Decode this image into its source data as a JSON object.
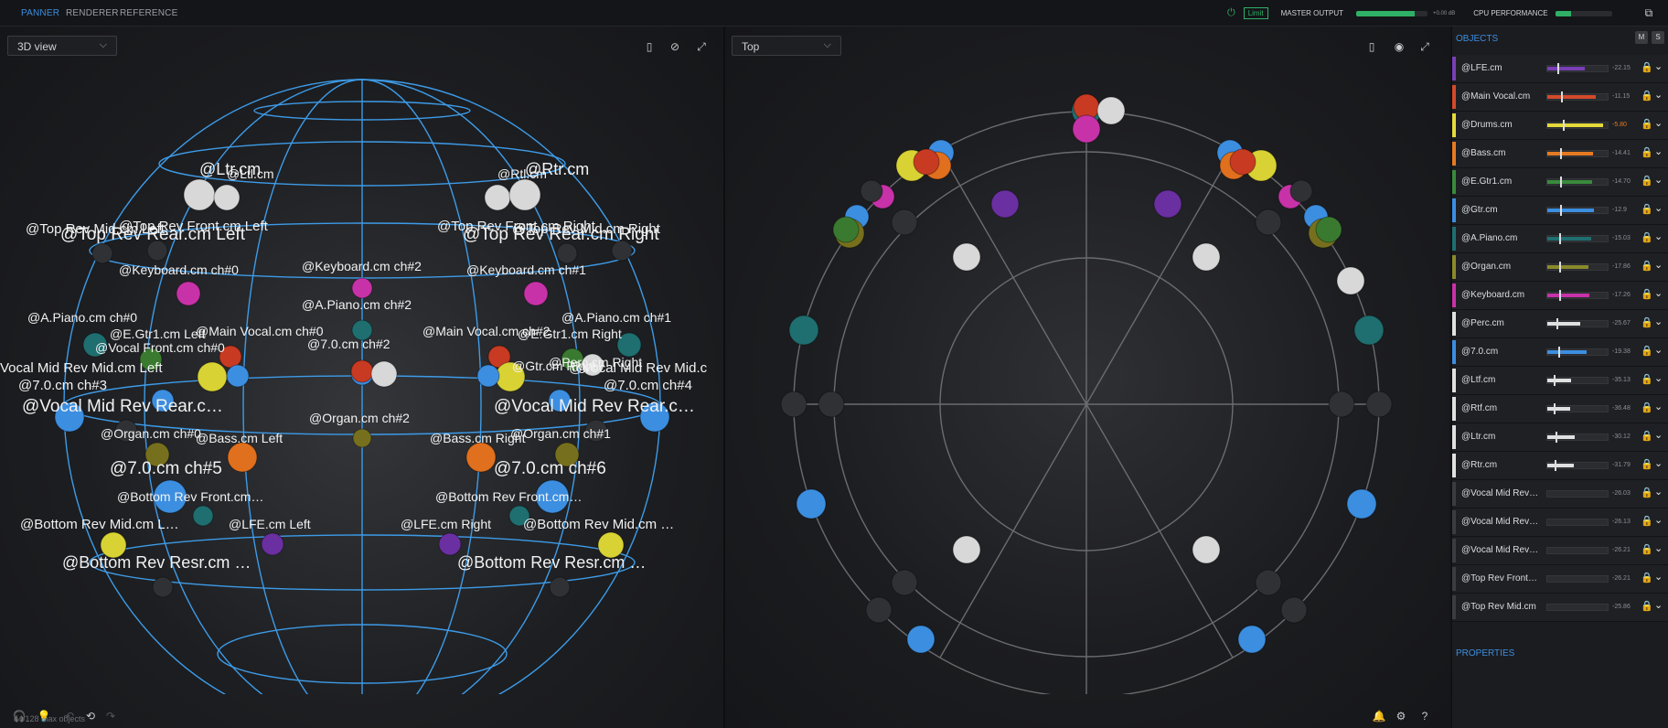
{
  "tabs": [
    "PANNER",
    "RENDERER",
    "REFERENCE"
  ],
  "topbar": {
    "limit_label": "Limit",
    "master_output_label": "MASTER OUTPUT",
    "master_output_db": "+0.00 dB",
    "master_output_level": 0.82,
    "cpu_label": "CPU PERFORMANCE",
    "cpu_level": 0.28,
    "accent_color": "#3c8ee0",
    "limit_color": "#2fb067"
  },
  "left_view": {
    "select_value": "3D view",
    "footer": "54/128 max objects",
    "labels": [
      "@Ltr.cm",
      "@Ltl.cm",
      "@Rtl.cm",
      "@Rtr.cm",
      "@Top Rev Mid.cm Left",
      "@Top Rev Front.cm Left",
      "@Top Rev Rear.cm Left",
      "@Top Rev Front.cm Right",
      "@Top Rev Mid.cm Right",
      "@Top Rev Rear.cm Right",
      "@Keyboard.cm ch#0",
      "@Keyboard.cm ch#2",
      "@Keyboard.cm ch#1",
      "@A.Piano.cm ch#2",
      "@A.Piano.cm ch#0",
      "@A.Piano.cm ch#1",
      "@E.Gtr1.cm Left",
      "@Main Vocal.cm ch#0",
      "@Main Vocal.cm ch#2",
      "@E.Gtr1.cm Right",
      "@Vocal Front.cm ch#0",
      "@7.0.cm ch#2",
      "@Perc.cm Right",
      "@Gtr.cm Right",
      "Vocal Mid Rev Mid.cm Left",
      "@Vocal Mid Rev Mid.c",
      "@7.0.cm ch#3",
      "@7.0.cm ch#4",
      "@Vocal Mid Rev Rear.c…",
      "@Vocal Mid Rev Rear.c…",
      "@Organ.cm ch#2",
      "@Organ.cm ch#0",
      "@Organ.cm ch#1",
      "@Bass.cm Left",
      "@Bass.cm Right",
      "@7.0.cm ch#5",
      "@7.0.cm ch#6",
      "@Bottom Rev Front.cm…",
      "@Bottom Rev Front.cm…",
      "@Bottom Rev Mid.cm L…",
      "@LFE.cm Left",
      "@LFE.cm Right",
      "@Bottom Rev Mid.cm …",
      "@Bottom Rev Resr.cm …",
      "@Bottom Rev Resr.cm …"
    ]
  },
  "right_view": {
    "select_value": "Top"
  },
  "objects": {
    "header": "OBJECTS",
    "m_label": "M",
    "s_label": "S",
    "properties_label": "PROPERTIES",
    "items": [
      {
        "name": "@LFE.cm",
        "db": "-22.15",
        "color": "#7a3fb5",
        "level": 0.62
      },
      {
        "name": "@Main Vocal.cm",
        "db": "-11.15",
        "color": "#d24a2a",
        "level": 0.8
      },
      {
        "name": "@Drums.cm",
        "db": "-5.80",
        "color": "#e5d93a",
        "level": 0.92
      },
      {
        "name": "@Bass.cm",
        "db": "-14.41",
        "color": "#e57a20",
        "level": 0.76
      },
      {
        "name": "@E.Gtr1.cm",
        "db": "-14.70",
        "color": "#3a8a3c",
        "level": 0.74
      },
      {
        "name": "@Gtr.cm",
        "db": "-12.9",
        "color": "#3c8ee0",
        "level": 0.78
      },
      {
        "name": "@A.Piano.cm",
        "db": "-15.03",
        "color": "#1f6e70",
        "level": 0.72
      },
      {
        "name": "@Organ.cm",
        "db": "-17.86",
        "color": "#8a8a2a",
        "level": 0.68
      },
      {
        "name": "@Keyboard.cm",
        "db": "-17.26",
        "color": "#c832a8",
        "level": 0.69
      },
      {
        "name": "@Perc.cm",
        "db": "-25.67",
        "color": "#e0e0e0",
        "level": 0.55
      },
      {
        "name": "@7.0.cm",
        "db": "-19.38",
        "color": "#3c8ee0",
        "level": 0.65
      },
      {
        "name": "@Ltf.cm",
        "db": "-35.13",
        "color": "#e0e0e0",
        "level": 0.4
      },
      {
        "name": "@Rtf.cm",
        "db": "-36.48",
        "color": "#e0e0e0",
        "level": 0.38
      },
      {
        "name": "@Ltr.cm",
        "db": "-30.12",
        "color": "#e0e0e0",
        "level": 0.46
      },
      {
        "name": "@Rtr.cm",
        "db": "-31.79",
        "color": "#e0e0e0",
        "level": 0.44
      },
      {
        "name": "@Vocal Mid Rev…",
        "db": "-26.03",
        "color": "#3a3c40",
        "level": 0
      },
      {
        "name": "@Vocal Mid Rev…",
        "db": "-26.13",
        "color": "#3a3c40",
        "level": 0
      },
      {
        "name": "@Vocal Mid Rev…",
        "db": "-26.21",
        "color": "#3a3c40",
        "level": 0
      },
      {
        "name": "@Top Rev Front…",
        "db": "-26.21",
        "color": "#3a3c40",
        "level": 0
      },
      {
        "name": "@Top Rev Mid.cm",
        "db": "-25.86",
        "color": "#3a3c40",
        "level": 0
      }
    ]
  }
}
